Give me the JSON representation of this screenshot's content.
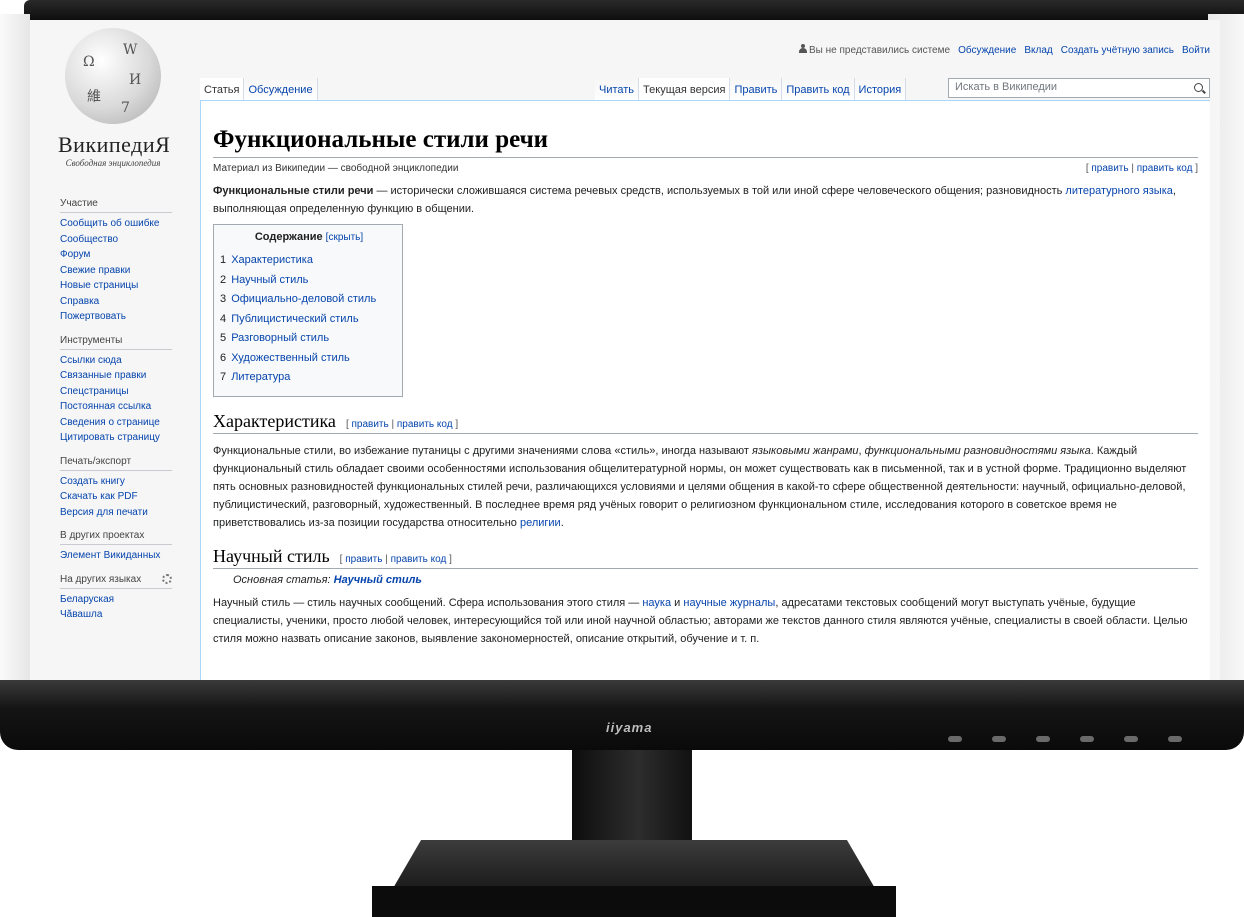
{
  "logo": {
    "glyphs": [
      "Ω",
      "W",
      "И",
      "維",
      "7"
    ],
    "wordmark": "ВикипедиЯ",
    "tagline": "Свободная энциклопедия"
  },
  "personal": {
    "not_logged": "Вы не представились системе",
    "links": [
      "Обсуждение",
      "Вклад",
      "Создать учётную запись",
      "Войти"
    ]
  },
  "tabs": {
    "left": [
      "Статья",
      "Обсуждение"
    ],
    "right": [
      "Читать",
      "Текущая версия",
      "Править",
      "Править код",
      "История"
    ]
  },
  "search": {
    "placeholder": "Искать в Википедии"
  },
  "sidebar": {
    "groups": [
      {
        "title": "Участие",
        "items": [
          "Сообщить об ошибке",
          "Сообщество",
          "Форум",
          "Свежие правки",
          "Новые страницы",
          "Справка",
          "Пожертвовать"
        ]
      },
      {
        "title": "Инструменты",
        "items": [
          "Ссылки сюда",
          "Связанные правки",
          "Спецстраницы",
          "Постоянная ссылка",
          "Сведения о странице",
          "Цитировать страницу"
        ]
      },
      {
        "title": "Печать/экспорт",
        "items": [
          "Создать книгу",
          "Скачать как PDF",
          "Версия для печати"
        ]
      },
      {
        "title": "В других проектах",
        "items": [
          "Элемент Викиданных"
        ]
      },
      {
        "title": "На других языках",
        "items": [
          "Беларуская",
          "Чăвашла"
        ]
      }
    ]
  },
  "article": {
    "title": "Функциональные стили речи",
    "site_sub": "Материал из Википедии — свободной энциклопедии",
    "edit": "править",
    "edit_code": "править код",
    "lead": {
      "bold": "Функциональные стили речи",
      "t1": " — исторически сложившаяся система речевых средств, используемых в той или иной сфере человеческого общения; разновидность ",
      "link": "литературного языка",
      "t2": ", выполняющая определенную функцию в общении."
    },
    "toc": {
      "title": "Содержание",
      "toggle": "[скрыть]",
      "items": [
        {
          "num": "1",
          "label": "Характеристика"
        },
        {
          "num": "2",
          "label": "Научный стиль"
        },
        {
          "num": "3",
          "label": "Официально-деловой стиль"
        },
        {
          "num": "4",
          "label": "Публицистический стиль"
        },
        {
          "num": "5",
          "label": "Разговорный стиль"
        },
        {
          "num": "6",
          "label": "Художественный стиль"
        },
        {
          "num": "7",
          "label": "Литература"
        }
      ]
    },
    "sec1": {
      "heading": "Характеристика",
      "t1": "Функциональные стили, во избежание путаницы с другими значениями слова «стиль», иногда называют ",
      "i1": "языковыми жанрами",
      "t2": ", ",
      "i2": "функциональными разновидностями языка",
      "t3": ". Каждый функциональный стиль обладает своими особенностями использования общелитературной нормы, он может существовать как в письменной, так и в устной форме. Традиционно выделяют пять основных разновидностей функциональных стилей речи, различающихся условиями и целями общения в какой-то сфере общественной деятельности: научный, официально-деловой, публицистический, разговорный, художественный. В последнее время ряд учёных говорит о религиозном функциональном стиле, исследования которого в советское время не приветствовались из-за позиции государства относительно ",
      "link": "религии",
      "t4": "."
    },
    "sec2": {
      "heading": "Научный стиль",
      "hatnote_prefix": "Основная статья: ",
      "hatnote_link": "Научный стиль",
      "t1": "Научный стиль — стиль научных сообщений. Сфера использования этого стиля — ",
      "link1": "наука",
      "t2": " и ",
      "link2": "научные журналы",
      "t3": ", адресатами текстовых сообщений могут выступать учёные, будущие специалисты, ученики, просто любой человек, интересующийся той или иной научной областью; авторами же текстов данного стиля являются учёные, специалисты в своей области. Целью стиля можно назвать описание законов, выявление закономерностей, описание открытий, обучение и т. п."
    }
  },
  "monitor": {
    "brand": "iiyama"
  }
}
